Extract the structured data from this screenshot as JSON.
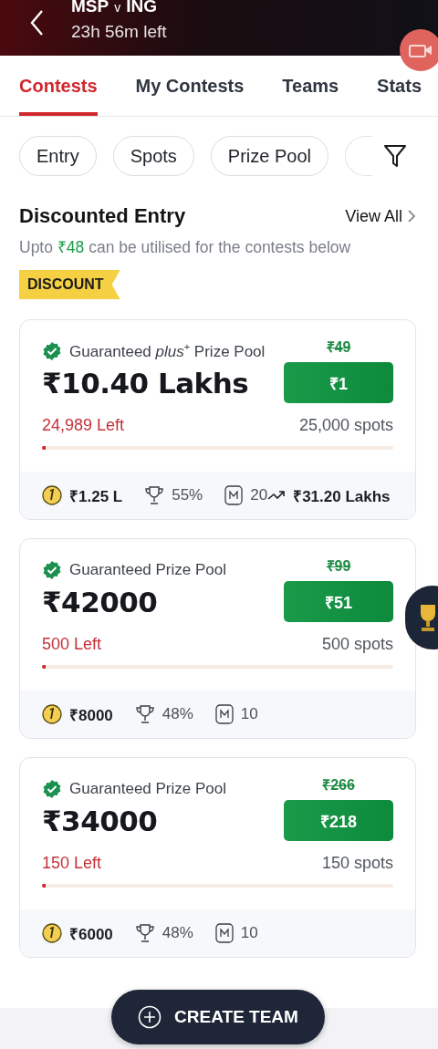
{
  "header": {
    "team_1": "MSP",
    "versus": "v",
    "team_2": "ING",
    "time_left": "23h 56m left"
  },
  "tabs": [
    {
      "label": "Contests",
      "selected": true
    },
    {
      "label": "My Contests",
      "selected": false
    },
    {
      "label": "Teams",
      "selected": false
    },
    {
      "label": "Stats",
      "selected": false
    }
  ],
  "filters": [
    {
      "label": "Entry"
    },
    {
      "label": "Spots"
    },
    {
      "label": "Prize Pool"
    }
  ],
  "section": {
    "title": "Discounted Entry",
    "view_all": "View All",
    "subtitle_prefix": "Upto",
    "amount": "₹48",
    "subtitle_suffix": "can be utilised for the contests below",
    "ribbon": "DISCOUNT"
  },
  "contests": [
    {
      "pool_label": "Guaranteed *plus*$^{+}$ Prize Pool",
      "original_fee": "₹49",
      "entry_fee": "₹1",
      "prize_pool": "₹10.40 Lakhs",
      "spots_left": "24,989 Left",
      "total_spots": "25,000 spots",
      "level": 0.01,
      "first_prize": "₹1.25 L",
      "win_rate": "55%",
      "max_entries": "20",
      "trend_amount": "₹31.20 Lakhs"
    },
    {
      "pool_label": "Guaranteed Prize Pool",
      "original_fee": "₹99",
      "entry_fee": "₹51",
      "prize_pool": "₹42000",
      "spots_left": "500 Left",
      "total_spots": "500 spots",
      "level": 0.01,
      "first_prize": "₹8000",
      "win_rate": "48%",
      "max_entries": "10"
    },
    {
      "pool_label": "Guaranteed Prize Pool",
      "original_fee": "₹266",
      "entry_fee": "₹218",
      "prize_pool": "₹34000",
      "spots_left": "150 Left",
      "total_spots": "150 spots",
      "level": 0.01,
      "first_prize": "₹6000",
      "win_rate": "48%",
      "max_entries": "10"
    }
  ],
  "create_button": "CREATE TEAM"
}
